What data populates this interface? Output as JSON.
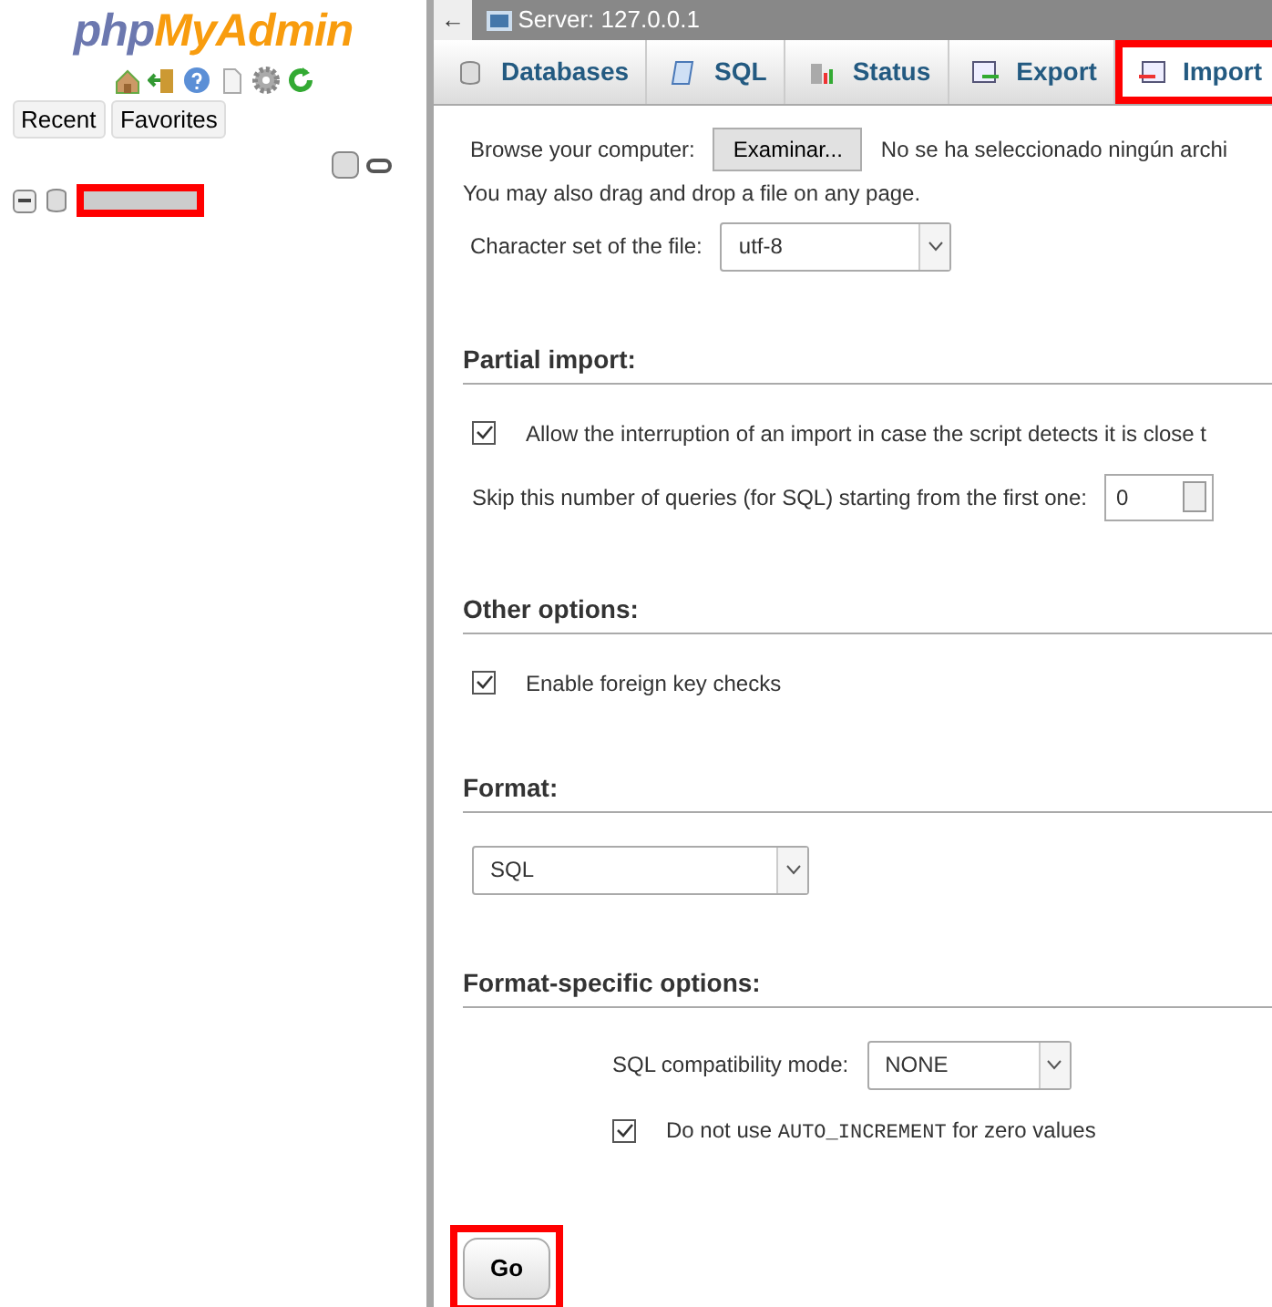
{
  "sidebar": {
    "logo": {
      "part_1": "php",
      "part_2": "MyAdmin"
    },
    "tabs": [
      {
        "label": "Recent"
      },
      {
        "label": "Favorites"
      }
    ],
    "tree": [
      {
        "blurred": true,
        "highlighted": true,
        "expanded": true
      }
    ]
  },
  "topbar": {
    "back": "←",
    "server": "Server: 127.0.0.1"
  },
  "tabs": [
    {
      "label": "Databases",
      "selected": false,
      "highlighted": false
    },
    {
      "label": "SQL",
      "selected": false,
      "highlighted": false
    },
    {
      "label": "Status",
      "selected": false,
      "highlighted": false
    },
    {
      "label": "Export",
      "selected": false,
      "highlighted": false
    },
    {
      "label": "Import",
      "selected": true,
      "highlighted": true
    }
  ],
  "file": {
    "browse_label": "Browse your computer:",
    "browse_button": "Examinar...",
    "no_file": "No se ha seleccionado ningún archi",
    "drag_note": "You may also drag and drop a file on any page.",
    "charset_label": "Character set of the file:",
    "charset": "utf-8"
  },
  "sections": [
    {
      "title": "Partial import:",
      "items": [
        {
          "kind": "checkbox",
          "label": "Allow the interruption of an import in case the script detects it is close t",
          "checked": true
        },
        {
          "kind": "number",
          "label": "Skip this number of queries (for SQL) starting from the first one:",
          "value": "0"
        }
      ]
    },
    {
      "title": "Other options:",
      "items": [
        {
          "kind": "checkbox",
          "label": "Enable foreign key checks",
          "checked": true
        }
      ]
    },
    {
      "title": "Format:",
      "items": [
        {
          "kind": "select",
          "value": "SQL"
        }
      ]
    },
    {
      "title": "Format-specific options:",
      "items": [
        {
          "kind": "select",
          "label": "SQL compatibility mode:",
          "value": "NONE",
          "indent": true
        },
        {
          "kind": "checkbox",
          "label": "Do not use ",
          "code": "AUTO_INCREMENT",
          "label_after": " for zero values",
          "checked": true,
          "indent": true
        }
      ]
    }
  ],
  "go_button": {
    "label": "Go",
    "highlighted": true
  }
}
